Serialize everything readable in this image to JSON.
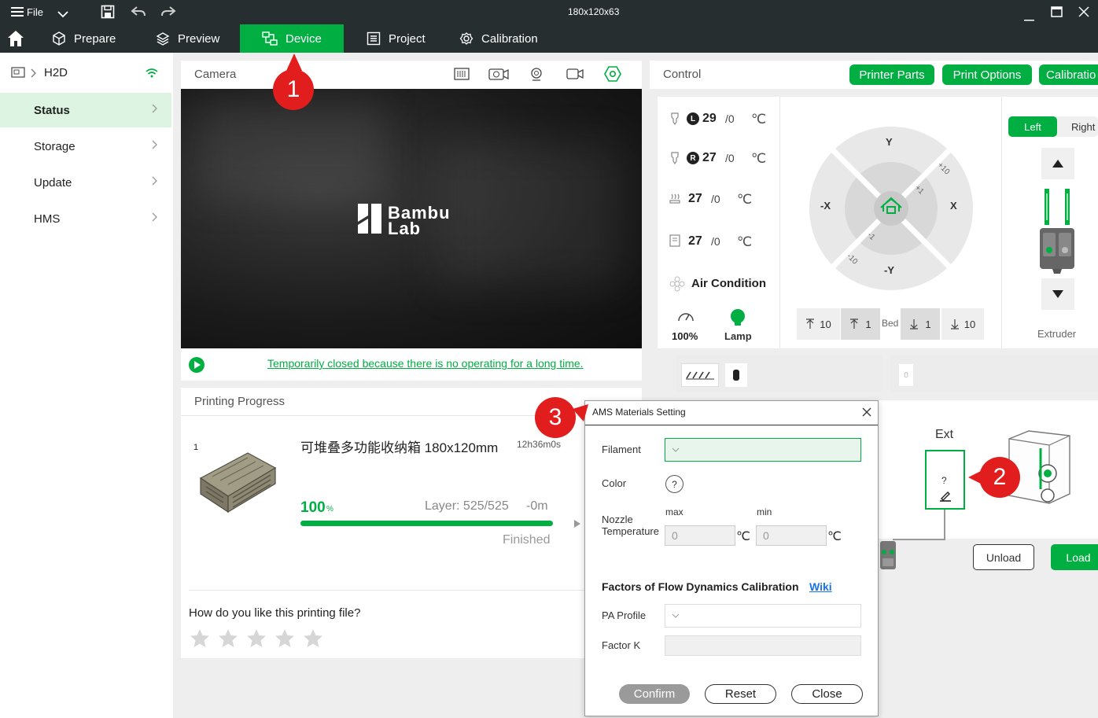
{
  "titlebar": {
    "menu_label": "File",
    "window_title": "180x120x63"
  },
  "nav": {
    "tabs": [
      {
        "label": "Prepare"
      },
      {
        "label": "Preview"
      },
      {
        "label": "Device"
      },
      {
        "label": "Project"
      },
      {
        "label": "Calibration"
      }
    ]
  },
  "sidebar": {
    "printer_name": "H2D",
    "items": [
      {
        "label": "Status"
      },
      {
        "label": "Storage"
      },
      {
        "label": "Update"
      },
      {
        "label": "HMS"
      }
    ]
  },
  "camera": {
    "title": "Camera",
    "logo_line1": "Bambu",
    "logo_line2": "Lab",
    "status_link": "Temporarily closed because there is no operating for a long time."
  },
  "progress": {
    "title": "Printing Progress",
    "plate_index": "1",
    "file_name": "可堆叠多功能收纳箱 180x120mm",
    "duration": "12h36m0s",
    "percent": "100",
    "percent_unit": "%",
    "percent_value": 100,
    "layer": "Layer: 525/525",
    "remaining": "-0m",
    "state": "Finished",
    "rating_question": "How do you like this printing file?",
    "stars": 5
  },
  "control": {
    "title": "Control",
    "buttons": {
      "printer_parts": "Printer Parts",
      "print_options": "Print Options",
      "calibration": "Calibratio"
    },
    "temps": [
      {
        "badge": "L",
        "current": "29",
        "target": "/0",
        "unit": "℃"
      },
      {
        "badge": "R",
        "current": "27",
        "target": "/0",
        "unit": "℃"
      },
      {
        "current": "27",
        "target": "/0",
        "unit": "℃"
      },
      {
        "current": "27",
        "target": "/0",
        "unit": "℃"
      }
    ],
    "air_condition": "Air Condition",
    "fan_speed": "100%",
    "lamp": "Lamp",
    "jog": {
      "y_plus": "Y",
      "y_minus": "-Y",
      "x_plus": "X",
      "x_minus": "-X",
      "plus10": "+10",
      "plus1": "+1",
      "minus1": "-1",
      "minus10": "-10"
    },
    "bed": {
      "up10": "10",
      "up1": "1",
      "label": "Bed",
      "down1": "1",
      "down10": "10"
    },
    "extruder": {
      "left": "Left",
      "right": "Right",
      "label": "Extruder"
    }
  },
  "ams": {
    "slot_hint": "0",
    "ext_label": "Ext",
    "ext_slot_mark": "?",
    "unload": "Unload",
    "load": "Load"
  },
  "dialog": {
    "title": "AMS Materials Setting",
    "filament_label": "Filament",
    "color_label": "Color",
    "color_mark": "?",
    "nozzle_label_line1": "Nozzle",
    "nozzle_label_line2": "Temperature",
    "max_label": "max",
    "min_label": "min",
    "max_value": "0",
    "min_value": "0",
    "temp_unit": "℃",
    "flow_title": "Factors of Flow Dynamics Calibration",
    "wiki_link": "Wiki",
    "pa_profile_label": "PA Profile",
    "factor_k_label": "Factor K",
    "confirm": "Confirm",
    "reset": "Reset",
    "close": "Close"
  },
  "annotations": {
    "badge1": "1",
    "badge2": "2",
    "badge3": "3"
  },
  "colors": {
    "accent": "#00ae42",
    "dark_bar": "#262e30",
    "badge_red": "#e21d1d",
    "link_blue": "#1a73e8"
  }
}
